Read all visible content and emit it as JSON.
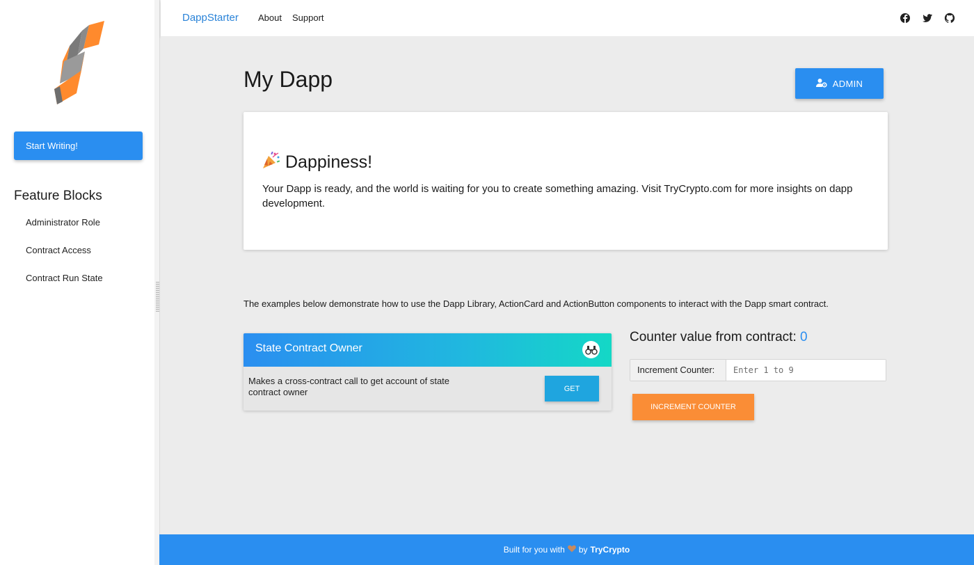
{
  "sidebar": {
    "logo_icon": "dappstarter-s-logo-icon",
    "start_button": "Start Writing!",
    "feature_title": "Feature Blocks",
    "features": [
      {
        "label": "Administrator Role"
      },
      {
        "label": "Contract Access"
      },
      {
        "label": "Contract Run State"
      }
    ]
  },
  "topbar": {
    "brand": "DappStarter",
    "links": [
      {
        "label": "About"
      },
      {
        "label": "Support"
      }
    ],
    "social_icons": [
      "facebook-icon",
      "twitter-icon",
      "github-icon"
    ]
  },
  "main": {
    "title": "My Dapp",
    "admin_button": "ADMIN",
    "hero": {
      "icon": "party-popper-icon",
      "title": "Dappiness!",
      "text": "Your Dapp is ready, and the world is waiting for you to create something amazing. Visit TryCrypto.com for more insights on dapp development."
    },
    "examples_text": "The examples below demonstrate how to use the Dapp Library, ActionCard and ActionButton components to interact with the Dapp smart contract.",
    "action_card": {
      "title": "State Contract Owner",
      "icon": "binoculars-icon",
      "description": "Makes a cross-contract call to get account of state contract owner",
      "button": "GET"
    },
    "counter": {
      "label": "Counter value from contract:",
      "value": "0",
      "input_label": "Increment Counter:",
      "input_placeholder": "Enter 1 to 9",
      "input_value": "",
      "button": "INCREMENT COUNTER"
    }
  },
  "footer": {
    "text": "Built for you with",
    "heart_icon": "heart-icon",
    "by": "by",
    "link": "TryCrypto"
  },
  "colors": {
    "primary": "#2a8ef0",
    "accent_orange": "#fa8d36",
    "card_gradient_end": "#14d8c6",
    "get_button": "#1fa5df"
  }
}
